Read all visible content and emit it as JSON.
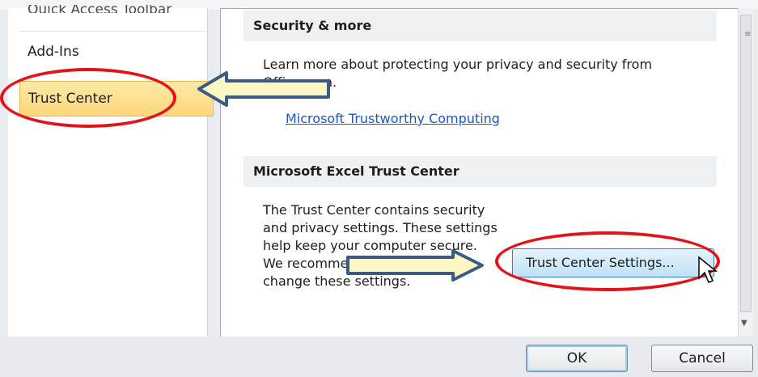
{
  "left_nav": {
    "items": [
      {
        "label": "Quick Access Toolbar"
      },
      {
        "label": "Add-Ins"
      },
      {
        "label": "Trust Center"
      }
    ]
  },
  "content": {
    "sections": [
      {
        "heading": "Security & more",
        "description": "Learn more about protecting your privacy and security from Office.com.",
        "link_label": "Microsoft Trustworthy Computing"
      },
      {
        "heading": "Microsoft Excel Trust Center",
        "description": "The Trust Center contains security and privacy settings. These settings help keep your computer secure. We recommend that you do not change these settings.",
        "button_label": "Trust Center Settings..."
      }
    ]
  },
  "footer": {
    "ok_label": "OK",
    "cancel_label": "Cancel"
  },
  "annotation_colors": {
    "ellipse": "#e0141a",
    "arrow_fill": "#fdf7c6",
    "arrow_stroke": "#3b5b82"
  }
}
